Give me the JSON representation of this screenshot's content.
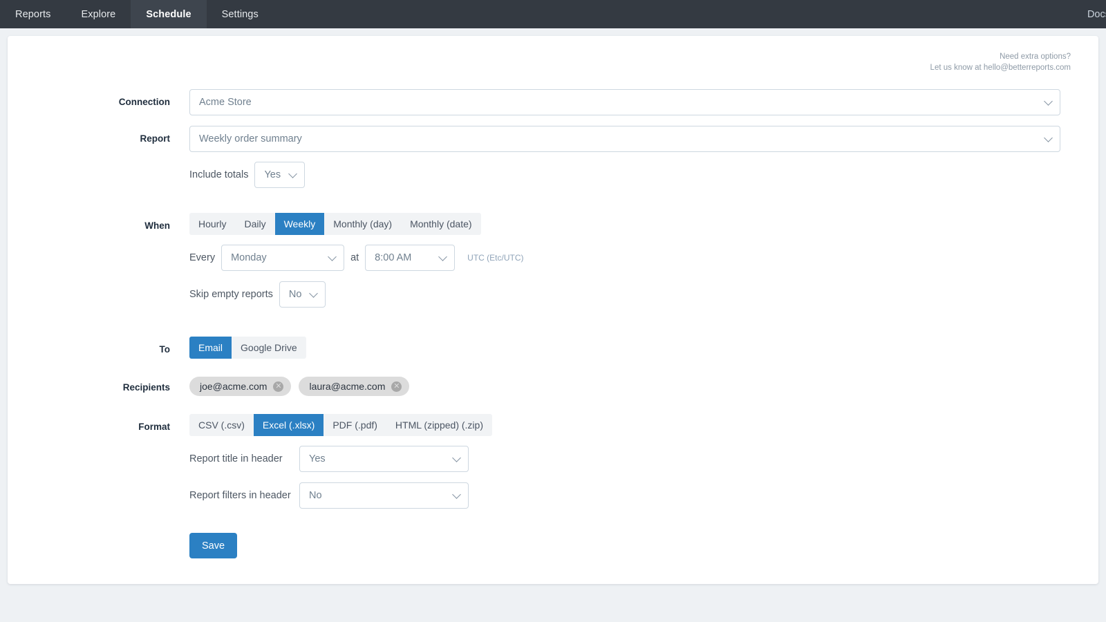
{
  "nav": {
    "items": [
      {
        "label": "Reports",
        "active": false
      },
      {
        "label": "Explore",
        "active": false
      },
      {
        "label": "Schedule",
        "active": true
      },
      {
        "label": "Settings",
        "active": false
      }
    ],
    "docs_label": "Docs"
  },
  "helper": {
    "line1": "Need extra options?",
    "line2": "Let us know at hello@betterreports.com"
  },
  "form": {
    "connection": {
      "label": "Connection",
      "value": "Acme Store"
    },
    "report": {
      "label": "Report",
      "value": "Weekly order summary"
    },
    "include_totals": {
      "label": "Include totals",
      "value": "Yes"
    },
    "when": {
      "label": "When",
      "tabs": [
        {
          "label": "Hourly",
          "active": false
        },
        {
          "label": "Daily",
          "active": false
        },
        {
          "label": "Weekly",
          "active": true
        },
        {
          "label": "Monthly (day)",
          "active": false
        },
        {
          "label": "Monthly (date)",
          "active": false
        }
      ],
      "every_label": "Every",
      "day_value": "Monday",
      "at_label": "at",
      "time_value": "8:00 AM",
      "timezone": "UTC (Etc/UTC)",
      "skip_empty_label": "Skip empty reports",
      "skip_empty_value": "No"
    },
    "to": {
      "label": "To",
      "tabs": [
        {
          "label": "Email",
          "active": true
        },
        {
          "label": "Google Drive",
          "active": false
        }
      ]
    },
    "recipients": {
      "label": "Recipients",
      "chips": [
        {
          "email": "joe@acme.com",
          "remove": "✕"
        },
        {
          "email": "laura@acme.com",
          "remove": "✕"
        }
      ]
    },
    "format": {
      "label": "Format",
      "tabs": [
        {
          "label": "CSV (.csv)",
          "active": false
        },
        {
          "label": "Excel (.xlsx)",
          "active": true
        },
        {
          "label": "PDF (.pdf)",
          "active": false
        },
        {
          "label": "HTML (zipped) (.zip)",
          "active": false
        }
      ],
      "title_in_header_label": "Report title in header",
      "title_in_header_value": "Yes",
      "filters_in_header_label": "Report filters in header",
      "filters_in_header_value": "No"
    },
    "save_label": "Save"
  },
  "colors": {
    "accent": "#2b80c3",
    "navbar": "#343a42",
    "page_bg": "#eef1f4"
  }
}
